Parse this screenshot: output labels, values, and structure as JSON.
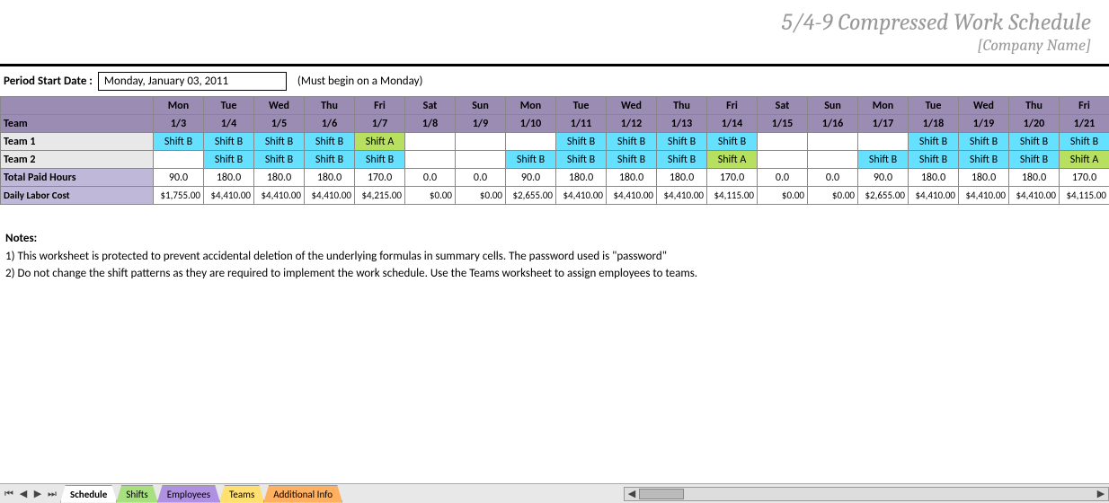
{
  "header": {
    "title": "5/4-9 Compressed Work Schedule",
    "company": "[Company Name]"
  },
  "period": {
    "label": "Period Start Date :",
    "value": "Monday, January 03, 2011",
    "hint": "(Must begin on a Monday)"
  },
  "columns": {
    "team_label": "Team",
    "days": [
      "Mon",
      "Tue",
      "Wed",
      "Thu",
      "Fri",
      "Sat",
      "Sun",
      "Mon",
      "Tue",
      "Wed",
      "Thu",
      "Fri",
      "Sat",
      "Sun",
      "Mon",
      "Tue",
      "Wed",
      "Thu",
      "Fri"
    ],
    "dates": [
      "1/3",
      "1/4",
      "1/5",
      "1/6",
      "1/7",
      "1/8",
      "1/9",
      "1/10",
      "1/11",
      "1/12",
      "1/13",
      "1/14",
      "1/15",
      "1/16",
      "1/17",
      "1/18",
      "1/19",
      "1/20",
      "1/21"
    ]
  },
  "teams": [
    {
      "name": "Team 1",
      "shifts": [
        "Shift B",
        "Shift B",
        "Shift B",
        "Shift B",
        "Shift A",
        "",
        "",
        "",
        "Shift B",
        "Shift B",
        "Shift B",
        "Shift B",
        "",
        "",
        "",
        "Shift B",
        "Shift B",
        "Shift B",
        "Shift B"
      ]
    },
    {
      "name": "Team 2",
      "shifts": [
        "",
        "Shift B",
        "Shift B",
        "Shift B",
        "Shift B",
        "",
        "",
        "Shift B",
        "Shift B",
        "Shift B",
        "Shift B",
        "Shift A",
        "",
        "",
        "Shift B",
        "Shift B",
        "Shift B",
        "Shift B",
        "Shift A"
      ]
    }
  ],
  "totals": {
    "paid_label": "Total Paid Hours",
    "paid": [
      "90.0",
      "180.0",
      "180.0",
      "180.0",
      "170.0",
      "0.0",
      "0.0",
      "90.0",
      "180.0",
      "180.0",
      "180.0",
      "170.0",
      "0.0",
      "0.0",
      "90.0",
      "180.0",
      "180.0",
      "180.0",
      "170.0"
    ],
    "cost_label": "Daily Labor Cost",
    "cost": [
      "$1,755.00",
      "$4,410.00",
      "$4,410.00",
      "$4,410.00",
      "$4,215.00",
      "$0.00",
      "$0.00",
      "$2,655.00",
      "$4,410.00",
      "$4,410.00",
      "$4,410.00",
      "$4,115.00",
      "$0.00",
      "$0.00",
      "$2,655.00",
      "$4,410.00",
      "$4,410.00",
      "$4,410.00",
      "$4,115.00"
    ]
  },
  "notes": {
    "header": "Notes:",
    "items": [
      "1) This worksheet is protected to prevent accidental deletion of the underlying formulas in summary cells. The password used is \"password\"",
      "2) Do not change the shift patterns as they are required to implement the work schedule.  Use the Teams worksheet to assign employees to teams."
    ]
  },
  "tabs": [
    {
      "label": "Schedule",
      "active": true,
      "color": "active"
    },
    {
      "label": "Shifts",
      "color": "green"
    },
    {
      "label": "Employees",
      "color": "purple"
    },
    {
      "label": "Teams",
      "color": "yellow"
    },
    {
      "label": "Additional Info",
      "color": "orange"
    }
  ],
  "chart_data": {
    "type": "table",
    "title": "5/4-9 Compressed Work Schedule",
    "columns": [
      "1/3",
      "1/4",
      "1/5",
      "1/6",
      "1/7",
      "1/8",
      "1/9",
      "1/10",
      "1/11",
      "1/12",
      "1/13",
      "1/14",
      "1/15",
      "1/16",
      "1/17",
      "1/18",
      "1/19",
      "1/20",
      "1/21"
    ],
    "rows": {
      "Team 1 shift": [
        "Shift B",
        "Shift B",
        "Shift B",
        "Shift B",
        "Shift A",
        "",
        "",
        "",
        "Shift B",
        "Shift B",
        "Shift B",
        "Shift B",
        "",
        "",
        "",
        "Shift B",
        "Shift B",
        "Shift B",
        "Shift B"
      ],
      "Team 2 shift": [
        "",
        "Shift B",
        "Shift B",
        "Shift B",
        "Shift B",
        "",
        "",
        "Shift B",
        "Shift B",
        "Shift B",
        "Shift B",
        "Shift A",
        "",
        "",
        "Shift B",
        "Shift B",
        "Shift B",
        "Shift B",
        "Shift A"
      ],
      "Total Paid Hours": [
        90,
        180,
        180,
        180,
        170,
        0,
        0,
        90,
        180,
        180,
        180,
        170,
        0,
        0,
        90,
        180,
        180,
        180,
        170
      ],
      "Daily Labor Cost": [
        1755,
        4410,
        4410,
        4410,
        4215,
        0,
        0,
        2655,
        4410,
        4410,
        4410,
        4115,
        0,
        0,
        2655,
        4410,
        4410,
        4410,
        4115
      ]
    }
  }
}
